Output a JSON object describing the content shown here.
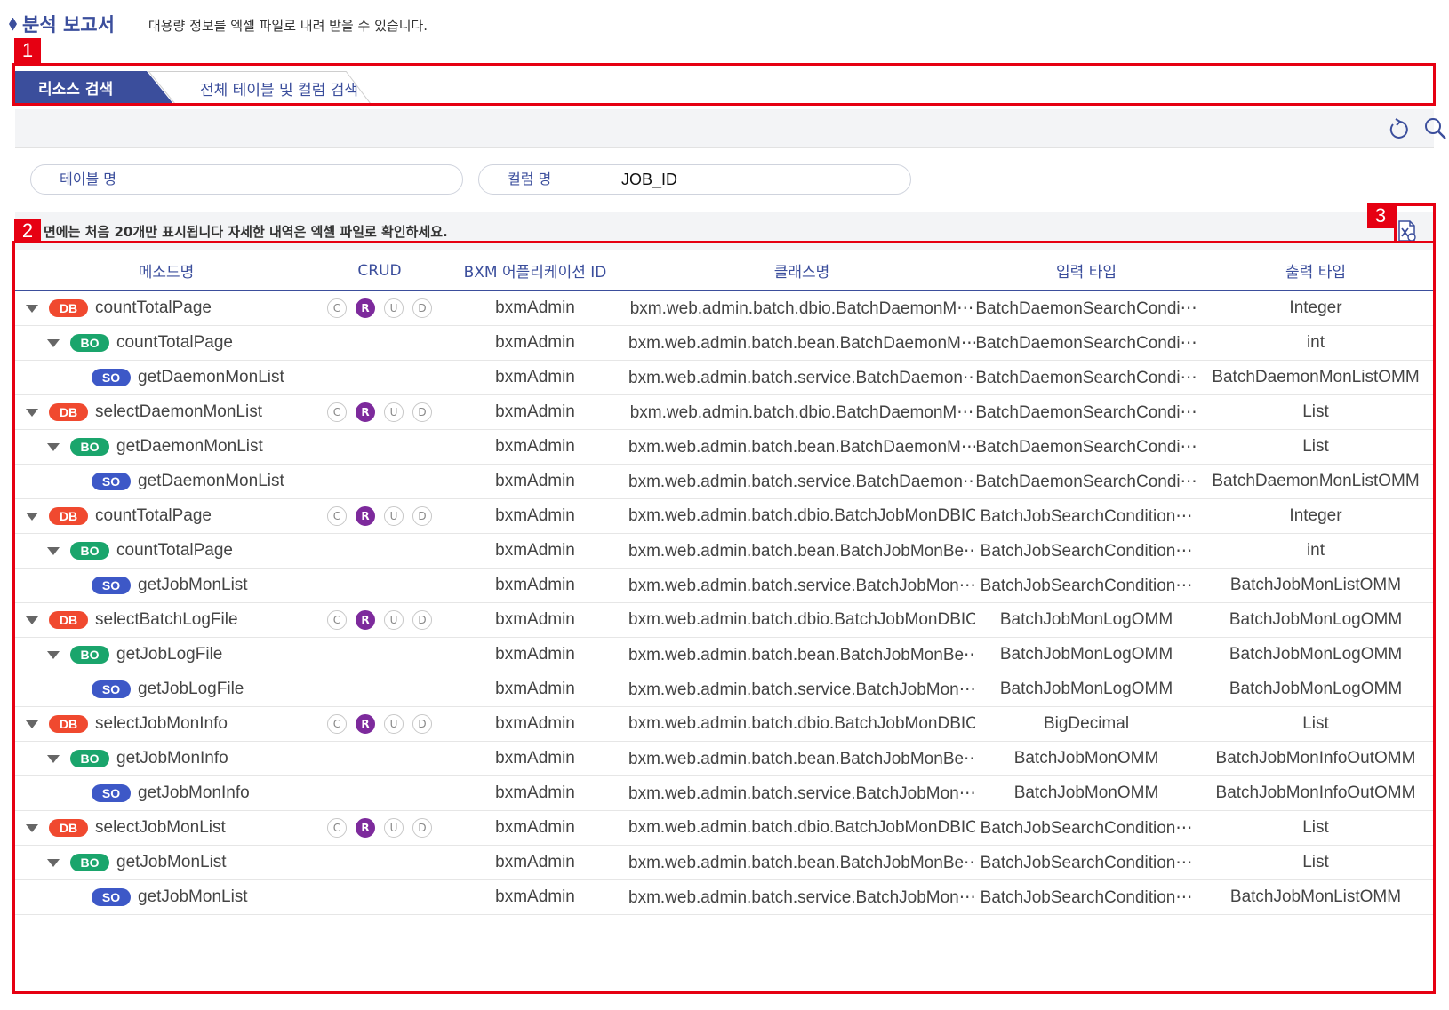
{
  "header": {
    "title": "분석 보고서",
    "description": "대용량 정보를 엑셀 파일로 내려 받을 수 있습니다."
  },
  "callouts": [
    "1",
    "2",
    "3"
  ],
  "tabs": [
    {
      "label": "리소스 검색",
      "active": true
    },
    {
      "label": "전체 테이블 및 컬럼 검색",
      "active": false
    }
  ],
  "toolbar": {
    "refresh_icon": "refresh-icon",
    "search_icon": "search-icon"
  },
  "search": {
    "table_label": "테이블 명",
    "table_value": "",
    "column_label": "컬럼 명",
    "column_value": "JOB_ID"
  },
  "notice": "면에는 처음 20개만 표시됩니다 자세한 내역은 엑셀 파일로 확인하세요.",
  "columns": [
    "메소드명",
    "CRUD",
    "BXM 어플리케이션 ID",
    "클래스명",
    "입력 타입",
    "출력 타입"
  ],
  "crud_letters": [
    "C",
    "R",
    "U",
    "D"
  ],
  "rows": [
    {
      "level": 0,
      "tag": "DB",
      "method": "countTotalPage",
      "crud": "R",
      "app": "bxmAdmin",
      "class": "bxm.web.admin.batch.dbio.BatchDaemonM⋯",
      "input": "BatchDaemonSearchCondi⋯",
      "output": "Integer"
    },
    {
      "level": 1,
      "tag": "BO",
      "method": "countTotalPage",
      "crud": "",
      "app": "bxmAdmin",
      "class": "bxm.web.admin.batch.bean.BatchDaemonM⋯",
      "input": "BatchDaemonSearchCondi⋯",
      "output": "int"
    },
    {
      "level": 2,
      "tag": "SO",
      "method": "getDaemonMonList",
      "crud": "",
      "app": "bxmAdmin",
      "class": "bxm.web.admin.batch.service.BatchDaemon⋯",
      "input": "BatchDaemonSearchCondi⋯",
      "output": "BatchDaemonMonListOMM"
    },
    {
      "level": 0,
      "tag": "DB",
      "method": "selectDaemonMonList",
      "crud": "R",
      "app": "bxmAdmin",
      "class": "bxm.web.admin.batch.dbio.BatchDaemonM⋯",
      "input": "BatchDaemonSearchCondi⋯",
      "output": "List"
    },
    {
      "level": 1,
      "tag": "BO",
      "method": "getDaemonMonList",
      "crud": "",
      "app": "bxmAdmin",
      "class": "bxm.web.admin.batch.bean.BatchDaemonM⋯",
      "input": "BatchDaemonSearchCondi⋯",
      "output": "List"
    },
    {
      "level": 2,
      "tag": "SO",
      "method": "getDaemonMonList",
      "crud": "",
      "app": "bxmAdmin",
      "class": "bxm.web.admin.batch.service.BatchDaemon⋯",
      "input": "BatchDaemonSearchCondi⋯",
      "output": "BatchDaemonMonListOMM"
    },
    {
      "level": 0,
      "tag": "DB",
      "method": "countTotalPage",
      "crud": "R",
      "app": "bxmAdmin",
      "class": "bxm.web.admin.batch.dbio.BatchJobMonDBIO",
      "input": "BatchJobSearchCondition⋯",
      "output": "Integer"
    },
    {
      "level": 1,
      "tag": "BO",
      "method": "countTotalPage",
      "crud": "",
      "app": "bxmAdmin",
      "class": "bxm.web.admin.batch.bean.BatchJobMonBe⋯",
      "input": "BatchJobSearchCondition⋯",
      "output": "int"
    },
    {
      "level": 2,
      "tag": "SO",
      "method": "getJobMonList",
      "crud": "",
      "app": "bxmAdmin",
      "class": "bxm.web.admin.batch.service.BatchJobMon⋯",
      "input": "BatchJobSearchCondition⋯",
      "output": "BatchJobMonListOMM"
    },
    {
      "level": 0,
      "tag": "DB",
      "method": "selectBatchLogFile",
      "crud": "R",
      "app": "bxmAdmin",
      "class": "bxm.web.admin.batch.dbio.BatchJobMonDBIO",
      "input": "BatchJobMonLogOMM",
      "output": "BatchJobMonLogOMM"
    },
    {
      "level": 1,
      "tag": "BO",
      "method": "getJobLogFile",
      "crud": "",
      "app": "bxmAdmin",
      "class": "bxm.web.admin.batch.bean.BatchJobMonBe⋯",
      "input": "BatchJobMonLogOMM",
      "output": "BatchJobMonLogOMM"
    },
    {
      "level": 2,
      "tag": "SO",
      "method": "getJobLogFile",
      "crud": "",
      "app": "bxmAdmin",
      "class": "bxm.web.admin.batch.service.BatchJobMon⋯",
      "input": "BatchJobMonLogOMM",
      "output": "BatchJobMonLogOMM"
    },
    {
      "level": 0,
      "tag": "DB",
      "method": "selectJobMonInfo",
      "crud": "R",
      "app": "bxmAdmin",
      "class": "bxm.web.admin.batch.dbio.BatchJobMonDBIO",
      "input": "BigDecimal",
      "output": "List"
    },
    {
      "level": 1,
      "tag": "BO",
      "method": "getJobMonInfo",
      "crud": "",
      "app": "bxmAdmin",
      "class": "bxm.web.admin.batch.bean.BatchJobMonBe⋯",
      "input": "BatchJobMonOMM",
      "output": "BatchJobMonInfoOutOMM"
    },
    {
      "level": 2,
      "tag": "SO",
      "method": "getJobMonInfo",
      "crud": "",
      "app": "bxmAdmin",
      "class": "bxm.web.admin.batch.service.BatchJobMon⋯",
      "input": "BatchJobMonOMM",
      "output": "BatchJobMonInfoOutOMM"
    },
    {
      "level": 0,
      "tag": "DB",
      "method": "selectJobMonList",
      "crud": "R",
      "app": "bxmAdmin",
      "class": "bxm.web.admin.batch.dbio.BatchJobMonDBIO",
      "input": "BatchJobSearchCondition⋯",
      "output": "List"
    },
    {
      "level": 1,
      "tag": "BO",
      "method": "getJobMonList",
      "crud": "",
      "app": "bxmAdmin",
      "class": "bxm.web.admin.batch.bean.BatchJobMonBe⋯",
      "input": "BatchJobSearchCondition⋯",
      "output": "List"
    },
    {
      "level": 2,
      "tag": "SO",
      "method": "getJobMonList",
      "crud": "",
      "app": "bxmAdmin",
      "class": "bxm.web.admin.batch.service.BatchJobMon⋯",
      "input": "BatchJobSearchCondition⋯",
      "output": "BatchJobMonListOMM"
    }
  ],
  "colors": {
    "accent": "#3b4e9c",
    "callout": "#e60012",
    "db": "#f0492f",
    "bo": "#1aa56c",
    "so": "#3d58c7",
    "crud_on": "#7d2a9c"
  }
}
